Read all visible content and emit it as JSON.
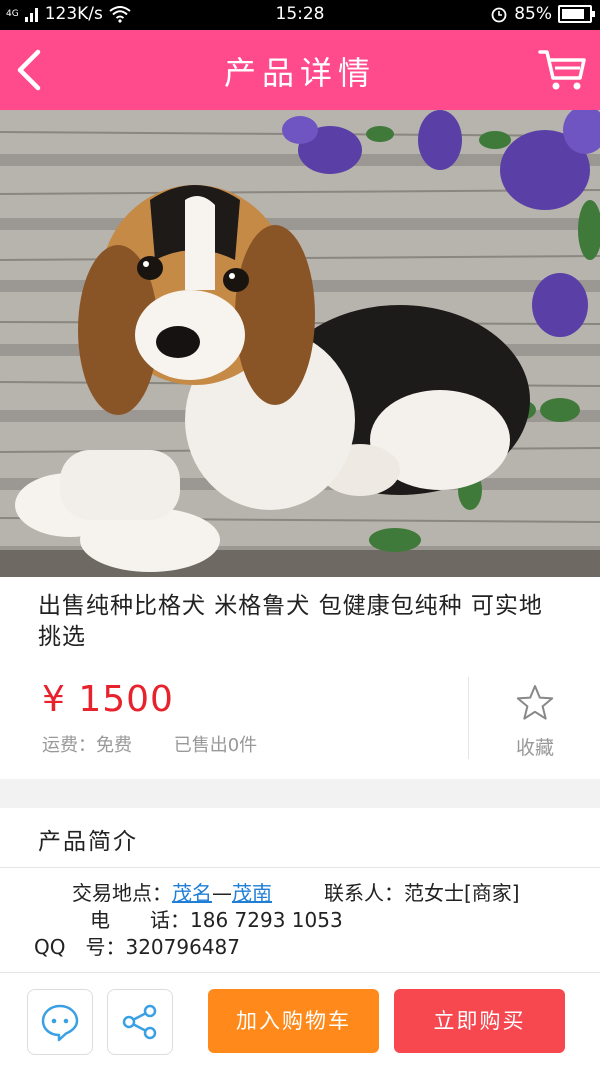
{
  "status_bar": {
    "network": "4G",
    "speed": "123K/s",
    "time": "15:28",
    "battery": "85%"
  },
  "header": {
    "title": "产品详情"
  },
  "product": {
    "title": "出售纯种比格犬 米格鲁犬 包健康包纯种 可实地挑选",
    "price": "¥ 1500",
    "shipping": "运费：免费",
    "sold": "已售出0件",
    "favorite_label": "收藏"
  },
  "intro": {
    "heading": "产品简介",
    "location_label": "交易地点：",
    "location_city": "茂名",
    "location_sep": "—",
    "location_district": "茂南",
    "contact_label": "联系人：",
    "contact_name": "范女士[商家]",
    "phone_label": "电　　话：",
    "phone": "186 7293 1053",
    "qq_label": "QQ　号：",
    "qq": "320796487"
  },
  "actions": {
    "add_to_cart": "加入购物车",
    "buy_now": "立即购买"
  },
  "colors": {
    "brand_pink": "#ff4b8c",
    "price_red": "#e8222c",
    "cart_orange": "#ff8a1b",
    "buy_red": "#f7474f",
    "link_blue": "#1f7fd6",
    "icon_blue": "#3aa0e4"
  }
}
